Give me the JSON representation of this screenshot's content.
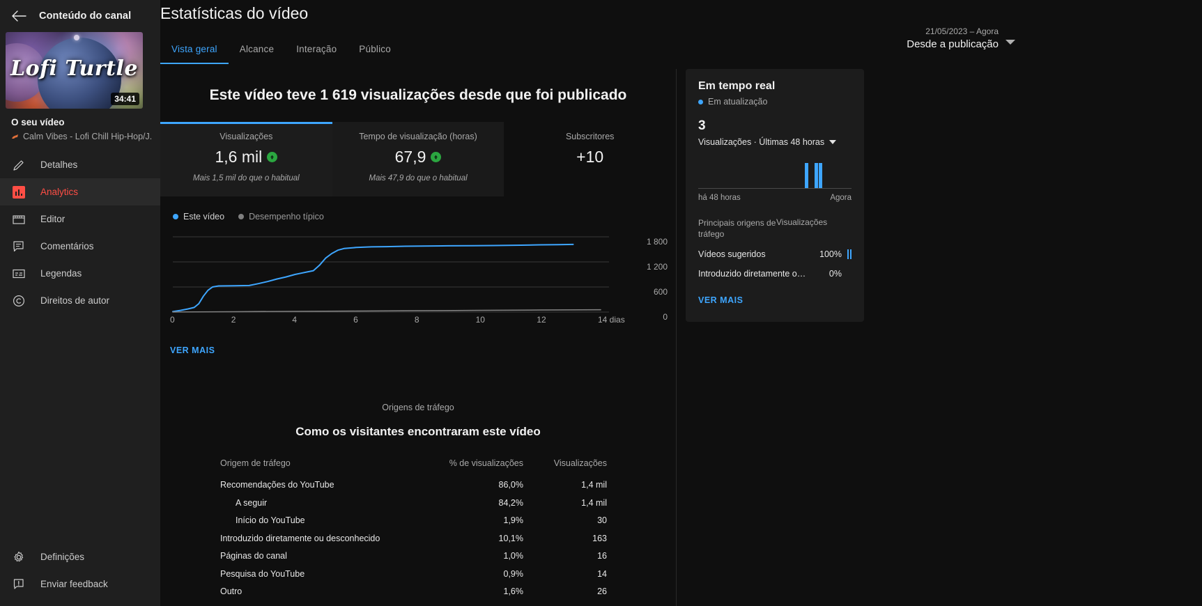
{
  "sidebar": {
    "header_title": "Conteúdo do canal",
    "back_icon": "arrow-left-icon",
    "thumbnail": {
      "overlay_text": "Lofi Turtle",
      "duration": "34:41"
    },
    "video_label": "O seu vídeo",
    "video_name": "Calm Vibes - Lofi Chill Hip-Hop/J...",
    "items": [
      {
        "label": "Detalhes",
        "icon": "pencil-icon",
        "active": false
      },
      {
        "label": "Analytics",
        "icon": "analytics-icon",
        "active": true
      },
      {
        "label": "Editor",
        "icon": "film-icon",
        "active": false
      },
      {
        "label": "Comentários",
        "icon": "comment-icon",
        "active": false
      },
      {
        "label": "Legendas",
        "icon": "subtitles-icon",
        "active": false
      },
      {
        "label": "Direitos de autor",
        "icon": "copyright-icon",
        "active": false
      }
    ],
    "bottom_items": [
      {
        "label": "Definições",
        "icon": "gear-icon"
      },
      {
        "label": "Enviar feedback",
        "icon": "feedback-icon"
      }
    ]
  },
  "header": {
    "title": "Estatísticas do vídeo",
    "tabs": [
      {
        "label": "Vista geral",
        "active": true
      },
      {
        "label": "Alcance",
        "active": false
      },
      {
        "label": "Interação",
        "active": false
      },
      {
        "label": "Público",
        "active": false
      }
    ],
    "date_range": "21/05/2023 – Agora",
    "date_label": "Desde a publicação",
    "caret_icon": "chevron-down-icon"
  },
  "overview": {
    "headline": "Este vídeo teve 1 619 visualizações desde que foi publicado",
    "cards": [
      {
        "label": "Visualizações",
        "value": "1,6 mil",
        "trend_icon": "arrow-up-circle-icon",
        "has_trend": true,
        "sub": "Mais 1,5 mil do que o habitual",
        "selected": true
      },
      {
        "label": "Tempo de visualização (horas)",
        "value": "67,9",
        "trend_icon": "arrow-up-circle-icon",
        "has_trend": true,
        "sub": "Mais 47,9 do que o habitual",
        "selected": false
      },
      {
        "label": "Subscritores",
        "value": "+10",
        "has_trend": false,
        "sub": "",
        "selected": false
      }
    ],
    "legend": [
      {
        "label": "Este vídeo",
        "color": "#3ea6ff"
      },
      {
        "label": "Desempenho típico",
        "color": "#808080"
      }
    ],
    "ver_mais": "VER MAIS"
  },
  "chart_data": {
    "type": "line",
    "title": "",
    "xlabel": "dias",
    "ylabel": "",
    "x_tick_labels": [
      "0",
      "2",
      "4",
      "6",
      "8",
      "10",
      "12",
      "14 dias"
    ],
    "x_ticks": [
      0,
      2,
      4,
      6,
      8,
      10,
      12,
      14
    ],
    "y_tick_labels": [
      "1 800",
      "1 200",
      "600",
      "0"
    ],
    "y_ticks": [
      1800,
      1200,
      600,
      0
    ],
    "xlim": [
      0,
      14
    ],
    "ylim": [
      0,
      1800
    ],
    "grid": true,
    "legend_position": "top-left",
    "series": [
      {
        "name": "Este vídeo",
        "color": "#3ea6ff",
        "x": [
          0,
          0.25,
          0.5,
          0.7,
          0.85,
          1.0,
          1.15,
          1.3,
          1.5,
          2.0,
          2.5,
          2.8,
          3.1,
          3.4,
          3.7,
          4.0,
          4.2,
          4.4,
          4.6,
          4.8,
          5.0,
          5.2,
          5.4,
          5.6,
          6.0,
          6.5,
          7.0,
          7.6,
          8.2,
          9.0,
          9.8,
          10.5,
          11.4,
          12.0,
          12.6,
          13.1
        ],
        "y": [
          10,
          40,
          75,
          110,
          200,
          380,
          520,
          600,
          625,
          630,
          635,
          680,
          730,
          790,
          840,
          900,
          930,
          960,
          990,
          1120,
          1290,
          1400,
          1480,
          1520,
          1545,
          1560,
          1565,
          1575,
          1580,
          1585,
          1588,
          1592,
          1600,
          1608,
          1614,
          1619
        ]
      },
      {
        "name": "Desempenho típico",
        "color": "#808080",
        "x": [
          0,
          2,
          4,
          6,
          8,
          10,
          12,
          14
        ],
        "y": [
          2,
          8,
          16,
          24,
          32,
          40,
          48,
          55
        ]
      }
    ]
  },
  "traffic": {
    "section_sub": "Origens de tráfego",
    "section_title": "Como os visitantes encontraram este vídeo",
    "columns": [
      "Origem de tráfego",
      "% de visualizações",
      "Visualizações"
    ],
    "rows": [
      {
        "source": "Recomendações do YouTube",
        "percent": "86,0%",
        "views": "1,4 mil",
        "indent": false
      },
      {
        "source": "A seguir",
        "percent": "84,2%",
        "views": "1,4 mil",
        "indent": true
      },
      {
        "source": "Início do YouTube",
        "percent": "1,9%",
        "views": "30",
        "indent": true
      },
      {
        "source": "Introduzido diretamente ou desconhecido",
        "percent": "10,1%",
        "views": "163",
        "indent": false
      },
      {
        "source": "Páginas do canal",
        "percent": "1,0%",
        "views": "16",
        "indent": false
      },
      {
        "source": "Pesquisa do YouTube",
        "percent": "0,9%",
        "views": "14",
        "indent": false
      },
      {
        "source": "Outro",
        "percent": "1,6%",
        "views": "26",
        "indent": false
      }
    ]
  },
  "realtime": {
    "title": "Em tempo real",
    "status": "Em atualização",
    "count": "3",
    "selector": "Visualizações · Últimas 48 horas",
    "selector_caret": "chevron-down-icon",
    "axis_left": "há 48 horas",
    "axis_right": "Agora",
    "bars": [
      0,
      0,
      0,
      0,
      0,
      0,
      0,
      0,
      0,
      0,
      0,
      0,
      0,
      0,
      0,
      0,
      0,
      0,
      0,
      0,
      0,
      0,
      1,
      0,
      1,
      1,
      0,
      0,
      0,
      0,
      0,
      0
    ],
    "table_headers": [
      "Principais origens de tráfego",
      "Visualizações"
    ],
    "rows": [
      {
        "source": "Vídeos sugeridos",
        "percent": "100%"
      },
      {
        "source": "Introduzido diretamente ou de...",
        "percent": "0%"
      }
    ],
    "ver_mais": "VER MAIS"
  },
  "colors": {
    "accent_blue": "#3ea6ff",
    "accent_red": "#ff4e45",
    "green": "#2ba640",
    "bg": "#0f0f0f",
    "sidebar_bg": "#1f1f1f",
    "card_bg": "#1c1c1c"
  }
}
